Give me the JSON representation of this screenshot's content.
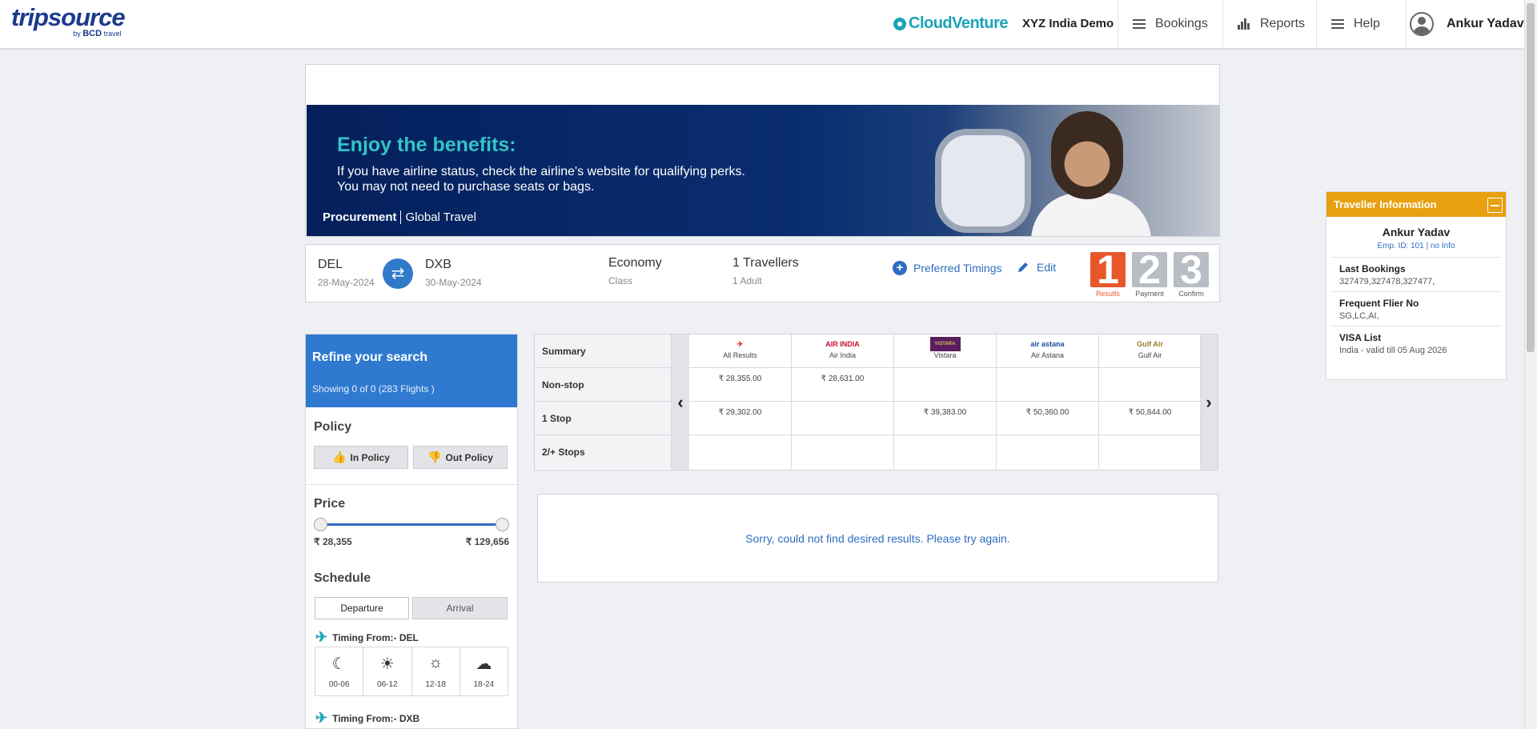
{
  "header": {
    "logo_main": "tripsource",
    "logo_sub_by": "by",
    "logo_sub_brand": "BCD",
    "logo_sub_travel": "travel",
    "partner_logo": "CloudVenture",
    "company": "XYZ India Demo",
    "nav": {
      "bookings": "Bookings",
      "reports": "Reports",
      "help": "Help"
    },
    "user": "Ankur Yadav"
  },
  "banner": {
    "title": "Enjoy the benefits:",
    "line1": "If you have airline status, check the airline's website for qualifying perks.",
    "line2": "You may not need to purchase seats or bags.",
    "foot_a": "Procurement",
    "foot_b": "Global Travel"
  },
  "search": {
    "origin": "DEL",
    "origin_date": "28-May-2024",
    "destination": "DXB",
    "destination_date": "30-May-2024",
    "class_value": "Economy",
    "class_label": "Class",
    "travellers": "1 Travellers",
    "travellers_detail": "1 Adult",
    "preferred_timings": "Preferred Timings",
    "edit": "Edit",
    "steps": [
      {
        "num": "1",
        "label": "Results",
        "color": "#e8572a"
      },
      {
        "num": "2",
        "label": "Payment",
        "color": "#b8bcc3"
      },
      {
        "num": "3",
        "label": "Confirm",
        "color": "#b8bcc3"
      }
    ]
  },
  "refine": {
    "title": "Refine your search",
    "showing": "Showing 0 of 0 (283 Flights )",
    "policy_title": "Policy",
    "in_policy": "In Policy",
    "out_policy": "Out Policy",
    "price_title": "Price",
    "price_min": "₹ 28,355",
    "price_max": "₹ 129,656",
    "schedule_title": "Schedule",
    "departure": "Departure",
    "arrival": "Arrival",
    "timing_del": "Timing From:- DEL",
    "timing_dxb": "Timing From:- DXB",
    "slots": [
      "00-06",
      "06-12",
      "12-18",
      "18-24"
    ]
  },
  "matrix": {
    "rows": [
      "Summary",
      "Non-stop",
      "1 Stop",
      "2/+ Stops"
    ],
    "airlines": [
      "All Results",
      "Air India",
      "Vistara",
      "Air Astana",
      "Gulf Air"
    ],
    "logos": [
      "✈",
      "AIR INDIA",
      "VISTARA",
      "air astana",
      "Gulf Air"
    ],
    "nonstop": [
      "₹ 28,355.00",
      "₹ 28,631.00",
      "",
      "",
      ""
    ],
    "one_stop": [
      "₹ 29,302.00",
      "",
      "₹ 39,383.00",
      "₹ 50,360.00",
      "₹ 50,844.00"
    ],
    "two_plus": [
      "",
      "",
      "",
      "",
      ""
    ]
  },
  "no_results": "Sorry, could not find desired results. Please try again.",
  "traveller": {
    "header": "Traveller Information",
    "name": "Ankur Yadav",
    "emp": "Emp. ID: 101 | no Info",
    "last_bookings_h": "Last Bookings",
    "last_bookings_v": "327479,327478,327477,",
    "ffn_h": "Frequent Flier No",
    "ffn_v": "SG,LC,AI,",
    "visa_h": "VISA List",
    "visa_v": "India - valid till 05 Aug 2026"
  }
}
